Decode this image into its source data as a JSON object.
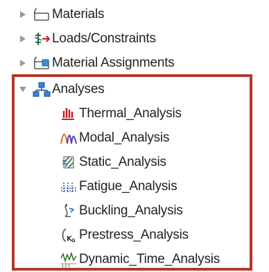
{
  "tree": {
    "items": [
      {
        "label": "Materials",
        "icon": "materials-folder-icon",
        "expanded": false
      },
      {
        "label": "Loads/Constraints",
        "icon": "loads-constraints-icon",
        "expanded": false
      },
      {
        "label": "Material Assignments",
        "icon": "material-assignments-icon",
        "expanded": false
      },
      {
        "label": "Analyses",
        "icon": "analyses-icon",
        "expanded": true,
        "children": [
          {
            "label": "Thermal_Analysis",
            "icon": "thermal-analysis-icon"
          },
          {
            "label": "Modal_Analysis",
            "icon": "modal-analysis-icon"
          },
          {
            "label": "Static_Analysis",
            "icon": "static-analysis-icon"
          },
          {
            "label": "Fatigue_Analysis",
            "icon": "fatigue-analysis-icon"
          },
          {
            "label": "Buckling_Analysis",
            "icon": "buckling-analysis-icon"
          },
          {
            "label": "Prestress_Analysis",
            "icon": "prestress-analysis-icon"
          },
          {
            "label": "Dynamic_Time_Analysis",
            "icon": "dynamic-time-analysis-icon"
          }
        ]
      }
    ]
  },
  "colors": {
    "highlight_border": "#b2392a",
    "arrow": "#9a9a9a",
    "text": "#222222"
  }
}
